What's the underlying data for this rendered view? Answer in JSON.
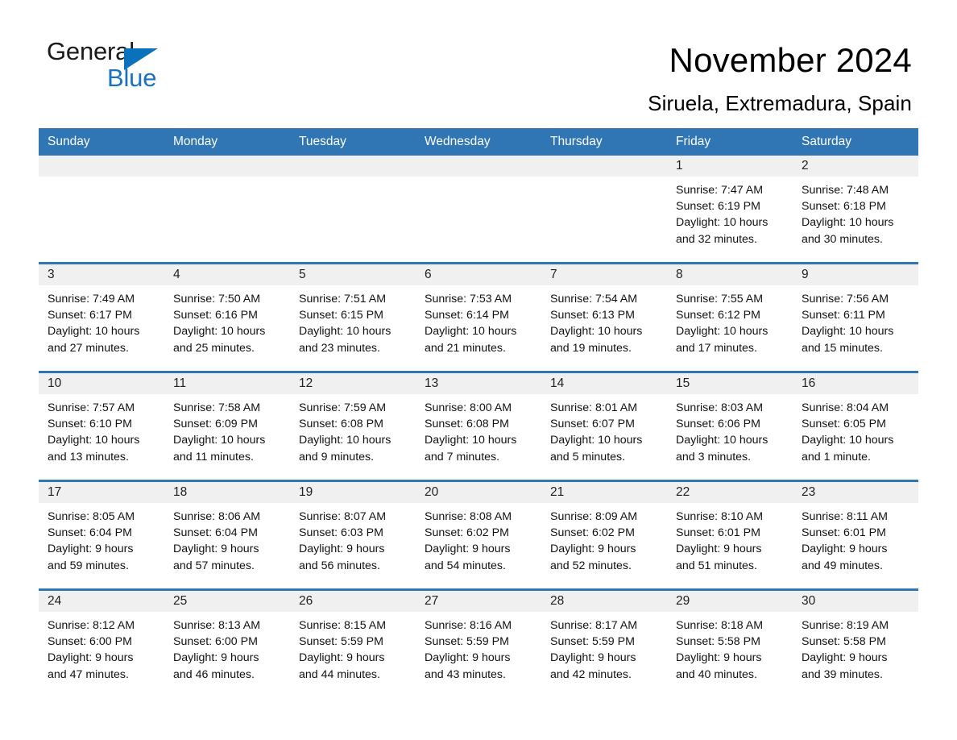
{
  "brand": {
    "word1": "General",
    "word2": "Blue",
    "triangle_color": "#0a72bd",
    "blue_color": "#1a72c0"
  },
  "header": {
    "title": "November 2024",
    "subtitle": "Siruela, Extremadura, Spain"
  },
  "theme": {
    "header_blue": "#3075b4",
    "day_strip_grey": "#f0f0f0",
    "text_black": "#000000"
  },
  "calendar": {
    "day_headers": [
      "Sunday",
      "Monday",
      "Tuesday",
      "Wednesday",
      "Thursday",
      "Friday",
      "Saturday"
    ],
    "weeks": [
      [
        {
          "day": "",
          "empty": true,
          "lines": []
        },
        {
          "day": "",
          "empty": true,
          "lines": []
        },
        {
          "day": "",
          "empty": true,
          "lines": []
        },
        {
          "day": "",
          "empty": true,
          "lines": []
        },
        {
          "day": "",
          "empty": true,
          "lines": []
        },
        {
          "day": "1",
          "empty": false,
          "lines": [
            "Sunrise: 7:47 AM",
            "Sunset: 6:19 PM",
            "Daylight: 10 hours",
            "and 32 minutes."
          ]
        },
        {
          "day": "2",
          "empty": false,
          "lines": [
            "Sunrise: 7:48 AM",
            "Sunset: 6:18 PM",
            "Daylight: 10 hours",
            "and 30 minutes."
          ]
        }
      ],
      [
        {
          "day": "3",
          "empty": false,
          "lines": [
            "Sunrise: 7:49 AM",
            "Sunset: 6:17 PM",
            "Daylight: 10 hours",
            "and 27 minutes."
          ]
        },
        {
          "day": "4",
          "empty": false,
          "lines": [
            "Sunrise: 7:50 AM",
            "Sunset: 6:16 PM",
            "Daylight: 10 hours",
            "and 25 minutes."
          ]
        },
        {
          "day": "5",
          "empty": false,
          "lines": [
            "Sunrise: 7:51 AM",
            "Sunset: 6:15 PM",
            "Daylight: 10 hours",
            "and 23 minutes."
          ]
        },
        {
          "day": "6",
          "empty": false,
          "lines": [
            "Sunrise: 7:53 AM",
            "Sunset: 6:14 PM",
            "Daylight: 10 hours",
            "and 21 minutes."
          ]
        },
        {
          "day": "7",
          "empty": false,
          "lines": [
            "Sunrise: 7:54 AM",
            "Sunset: 6:13 PM",
            "Daylight: 10 hours",
            "and 19 minutes."
          ]
        },
        {
          "day": "8",
          "empty": false,
          "lines": [
            "Sunrise: 7:55 AM",
            "Sunset: 6:12 PM",
            "Daylight: 10 hours",
            "and 17 minutes."
          ]
        },
        {
          "day": "9",
          "empty": false,
          "lines": [
            "Sunrise: 7:56 AM",
            "Sunset: 6:11 PM",
            "Daylight: 10 hours",
            "and 15 minutes."
          ]
        }
      ],
      [
        {
          "day": "10",
          "empty": false,
          "lines": [
            "Sunrise: 7:57 AM",
            "Sunset: 6:10 PM",
            "Daylight: 10 hours",
            "and 13 minutes."
          ]
        },
        {
          "day": "11",
          "empty": false,
          "lines": [
            "Sunrise: 7:58 AM",
            "Sunset: 6:09 PM",
            "Daylight: 10 hours",
            "and 11 minutes."
          ]
        },
        {
          "day": "12",
          "empty": false,
          "lines": [
            "Sunrise: 7:59 AM",
            "Sunset: 6:08 PM",
            "Daylight: 10 hours",
            "and 9 minutes."
          ]
        },
        {
          "day": "13",
          "empty": false,
          "lines": [
            "Sunrise: 8:00 AM",
            "Sunset: 6:08 PM",
            "Daylight: 10 hours",
            "and 7 minutes."
          ]
        },
        {
          "day": "14",
          "empty": false,
          "lines": [
            "Sunrise: 8:01 AM",
            "Sunset: 6:07 PM",
            "Daylight: 10 hours",
            "and 5 minutes."
          ]
        },
        {
          "day": "15",
          "empty": false,
          "lines": [
            "Sunrise: 8:03 AM",
            "Sunset: 6:06 PM",
            "Daylight: 10 hours",
            "and 3 minutes."
          ]
        },
        {
          "day": "16",
          "empty": false,
          "lines": [
            "Sunrise: 8:04 AM",
            "Sunset: 6:05 PM",
            "Daylight: 10 hours",
            "and 1 minute."
          ]
        }
      ],
      [
        {
          "day": "17",
          "empty": false,
          "lines": [
            "Sunrise: 8:05 AM",
            "Sunset: 6:04 PM",
            "Daylight: 9 hours",
            "and 59 minutes."
          ]
        },
        {
          "day": "18",
          "empty": false,
          "lines": [
            "Sunrise: 8:06 AM",
            "Sunset: 6:04 PM",
            "Daylight: 9 hours",
            "and 57 minutes."
          ]
        },
        {
          "day": "19",
          "empty": false,
          "lines": [
            "Sunrise: 8:07 AM",
            "Sunset: 6:03 PM",
            "Daylight: 9 hours",
            "and 56 minutes."
          ]
        },
        {
          "day": "20",
          "empty": false,
          "lines": [
            "Sunrise: 8:08 AM",
            "Sunset: 6:02 PM",
            "Daylight: 9 hours",
            "and 54 minutes."
          ]
        },
        {
          "day": "21",
          "empty": false,
          "lines": [
            "Sunrise: 8:09 AM",
            "Sunset: 6:02 PM",
            "Daylight: 9 hours",
            "and 52 minutes."
          ]
        },
        {
          "day": "22",
          "empty": false,
          "lines": [
            "Sunrise: 8:10 AM",
            "Sunset: 6:01 PM",
            "Daylight: 9 hours",
            "and 51 minutes."
          ]
        },
        {
          "day": "23",
          "empty": false,
          "lines": [
            "Sunrise: 8:11 AM",
            "Sunset: 6:01 PM",
            "Daylight: 9 hours",
            "and 49 minutes."
          ]
        }
      ],
      [
        {
          "day": "24",
          "empty": false,
          "lines": [
            "Sunrise: 8:12 AM",
            "Sunset: 6:00 PM",
            "Daylight: 9 hours",
            "and 47 minutes."
          ]
        },
        {
          "day": "25",
          "empty": false,
          "lines": [
            "Sunrise: 8:13 AM",
            "Sunset: 6:00 PM",
            "Daylight: 9 hours",
            "and 46 minutes."
          ]
        },
        {
          "day": "26",
          "empty": false,
          "lines": [
            "Sunrise: 8:15 AM",
            "Sunset: 5:59 PM",
            "Daylight: 9 hours",
            "and 44 minutes."
          ]
        },
        {
          "day": "27",
          "empty": false,
          "lines": [
            "Sunrise: 8:16 AM",
            "Sunset: 5:59 PM",
            "Daylight: 9 hours",
            "and 43 minutes."
          ]
        },
        {
          "day": "28",
          "empty": false,
          "lines": [
            "Sunrise: 8:17 AM",
            "Sunset: 5:59 PM",
            "Daylight: 9 hours",
            "and 42 minutes."
          ]
        },
        {
          "day": "29",
          "empty": false,
          "lines": [
            "Sunrise: 8:18 AM",
            "Sunset: 5:58 PM",
            "Daylight: 9 hours",
            "and 40 minutes."
          ]
        },
        {
          "day": "30",
          "empty": false,
          "lines": [
            "Sunrise: 8:19 AM",
            "Sunset: 5:58 PM",
            "Daylight: 9 hours",
            "and 39 minutes."
          ]
        }
      ]
    ]
  }
}
